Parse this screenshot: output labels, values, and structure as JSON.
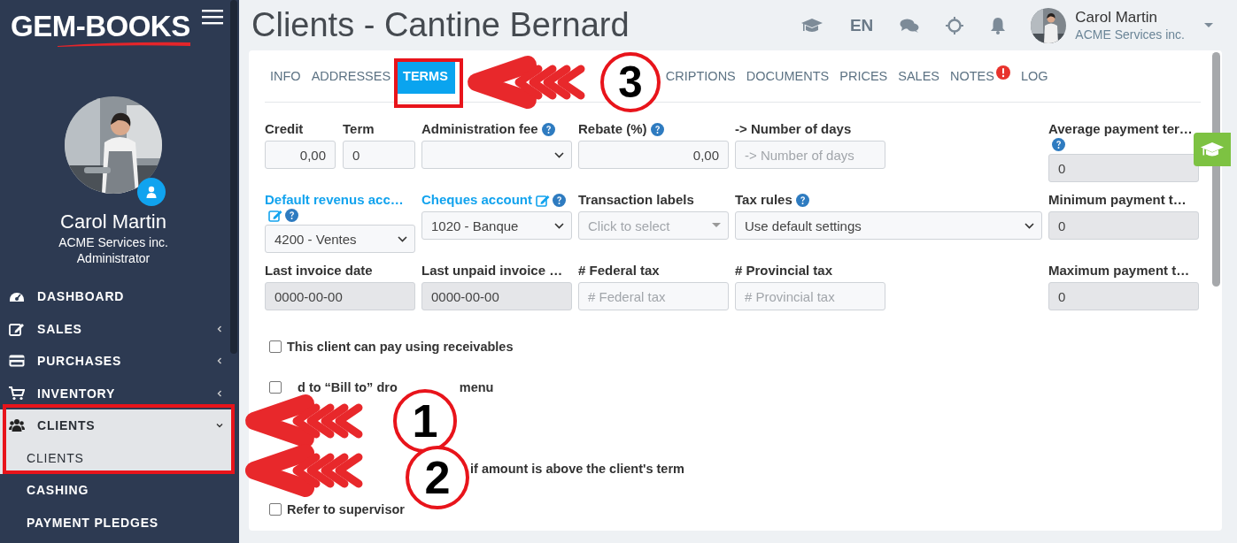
{
  "sidebar": {
    "logo": "GEM-BOOKS",
    "user": {
      "name": "Carol Martin",
      "company": "ACME Services inc.",
      "role": "Administrator"
    },
    "nav": [
      {
        "label": "DASHBOARD"
      },
      {
        "label": "SALES",
        "expanded": false
      },
      {
        "label": "PURCHASES",
        "expanded": false
      },
      {
        "label": "INVENTORY",
        "expanded": false
      },
      {
        "label": "CLIENTS",
        "expanded": true,
        "children": [
          {
            "label": "CLIENTS",
            "selected": true
          },
          {
            "label": "CASHING",
            "selected": false
          },
          {
            "label": "PAYMENT PLEDGES",
            "selected": false
          }
        ]
      }
    ]
  },
  "header": {
    "title": "Clients - Cantine Bernard",
    "language": "EN",
    "user": {
      "name": "Carol Martin",
      "company": "ACME Services inc."
    }
  },
  "tabs": [
    {
      "label": "INFO",
      "selected": false
    },
    {
      "label": "ADDRESSES",
      "selected": false
    },
    {
      "label": "TERMS",
      "selected": true
    },
    {
      "label": "CRIPTIONS",
      "selected": false
    },
    {
      "label": "DOCUMENTS",
      "selected": false
    },
    {
      "label": "PRICES",
      "selected": false
    },
    {
      "label": "SALES",
      "selected": false
    },
    {
      "label": "NOTES",
      "selected": false,
      "alert": true
    },
    {
      "label": "LOG",
      "selected": false
    }
  ],
  "form_rows": [
    [
      {
        "kind": "pair",
        "fields": [
          {
            "label": "Credit",
            "kind": "number",
            "value": "0,00",
            "disabled": false
          },
          {
            "label": "Term",
            "kind": "text",
            "value": "0",
            "disabled": false
          }
        ]
      },
      {
        "label": "Administration fee",
        "help": true,
        "kind": "select",
        "disabled": false
      },
      {
        "label": "Rebate (%)",
        "help": true,
        "kind": "number",
        "value": "0,00",
        "disabled": false
      },
      {
        "label": "-> Number of days",
        "kind": "text",
        "placeholder": "-> Number of days",
        "disabled": false
      },
      {
        "label": "Average payment ter…",
        "help": true,
        "kind": "text",
        "value": "0",
        "disabled": true
      }
    ],
    [
      {
        "label": "Default revenus acc…",
        "link": true,
        "edit": true,
        "help": true,
        "kind": "select",
        "value": "4200 - Ventes",
        "disabled": false
      },
      {
        "label": "Cheques account",
        "link": true,
        "edit": true,
        "help": true,
        "kind": "select",
        "value": "1020 - Banque",
        "disabled": false
      },
      {
        "label": "Transaction labels",
        "kind": "tags",
        "placeholder": "Click to select",
        "disabled": false
      },
      {
        "label": "Tax rules",
        "help": true,
        "kind": "select",
        "value": "Use default settings",
        "disabled": false
      },
      {
        "label": "Minimum payment t…",
        "kind": "text",
        "value": "0",
        "disabled": true
      }
    ],
    [
      {
        "label": "Last invoice date",
        "kind": "text",
        "value": "0000-00-00",
        "disabled": true
      },
      {
        "label": "Last unpaid invoice …",
        "kind": "text",
        "value": "0000-00-00",
        "disabled": true
      },
      {
        "label": "# Federal tax",
        "kind": "text",
        "placeholder": "# Federal tax",
        "disabled": false
      },
      {
        "label": "# Provincial tax",
        "kind": "text",
        "placeholder": "# Provincial tax",
        "disabled": false
      },
      {
        "label": "Maximum payment t…",
        "kind": "text",
        "value": "0",
        "disabled": true
      }
    ]
  ],
  "options": [
    {
      "checked": false,
      "parts": [
        "This client can pay using receivables"
      ]
    },
    {
      "checked": false,
      "parts": [
        "d to “Bill to” dro",
        "menu"
      ]
    },
    {
      "parts": [
        "if amount is above the client's term"
      ]
    },
    {
      "checked": false,
      "parts": [
        "Refer to supervisor"
      ]
    }
  ],
  "annotations": [
    {
      "number": "3"
    },
    {
      "number": "1"
    },
    {
      "number": "2"
    }
  ]
}
